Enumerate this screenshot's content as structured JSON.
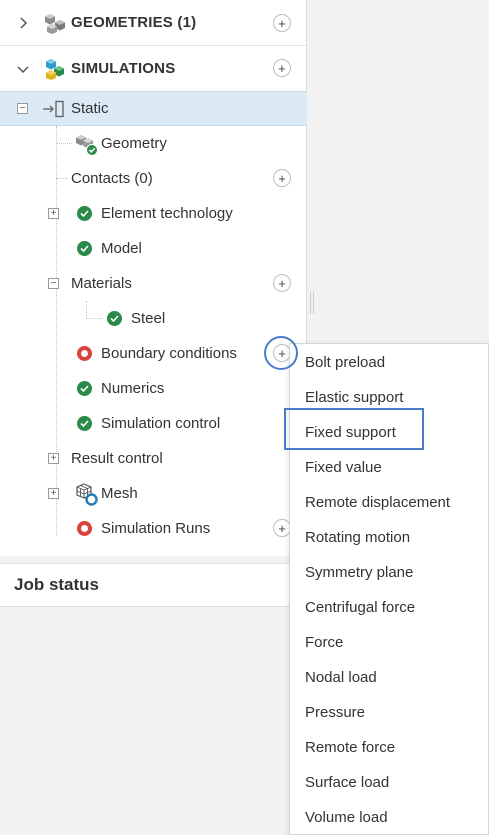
{
  "sections": {
    "geometries": {
      "label": "GEOMETRIES (1)",
      "add": "+"
    },
    "simulations": {
      "label": "SIMULATIONS",
      "add": "+"
    }
  },
  "tree": {
    "static": {
      "label": "Static",
      "toggle": "−"
    },
    "geometry": {
      "label": "Geometry"
    },
    "contacts": {
      "label": "Contacts (0)",
      "add": "+"
    },
    "element_technology": {
      "label": "Element technology",
      "toggle": "+"
    },
    "model": {
      "label": "Model"
    },
    "materials": {
      "label": "Materials",
      "toggle": "−",
      "add": "+"
    },
    "steel": {
      "label": "Steel"
    },
    "boundary_conditions": {
      "label": "Boundary conditions",
      "add": "+"
    },
    "numerics": {
      "label": "Numerics"
    },
    "simulation_control": {
      "label": "Simulation control"
    },
    "result_control": {
      "label": "Result control",
      "toggle": "+"
    },
    "mesh": {
      "label": "Mesh",
      "toggle": "+"
    },
    "simulation_runs": {
      "label": "Simulation Runs",
      "add": "+"
    }
  },
  "job_status": {
    "label": "Job status"
  },
  "menu": {
    "items": [
      "Bolt preload",
      "Elastic support",
      "Fixed support",
      "Fixed value",
      "Remote displacement",
      "Rotating motion",
      "Symmetry plane",
      "Centrifugal force",
      "Force",
      "Nodal load",
      "Pressure",
      "Remote force",
      "Surface load",
      "Volume load"
    ],
    "highlighted": "Fixed support"
  },
  "colors": {
    "ok": "#2a8a4a",
    "error": "#d9433b",
    "selection": "#dbeaf5",
    "highlight": "#4a7cc9"
  }
}
